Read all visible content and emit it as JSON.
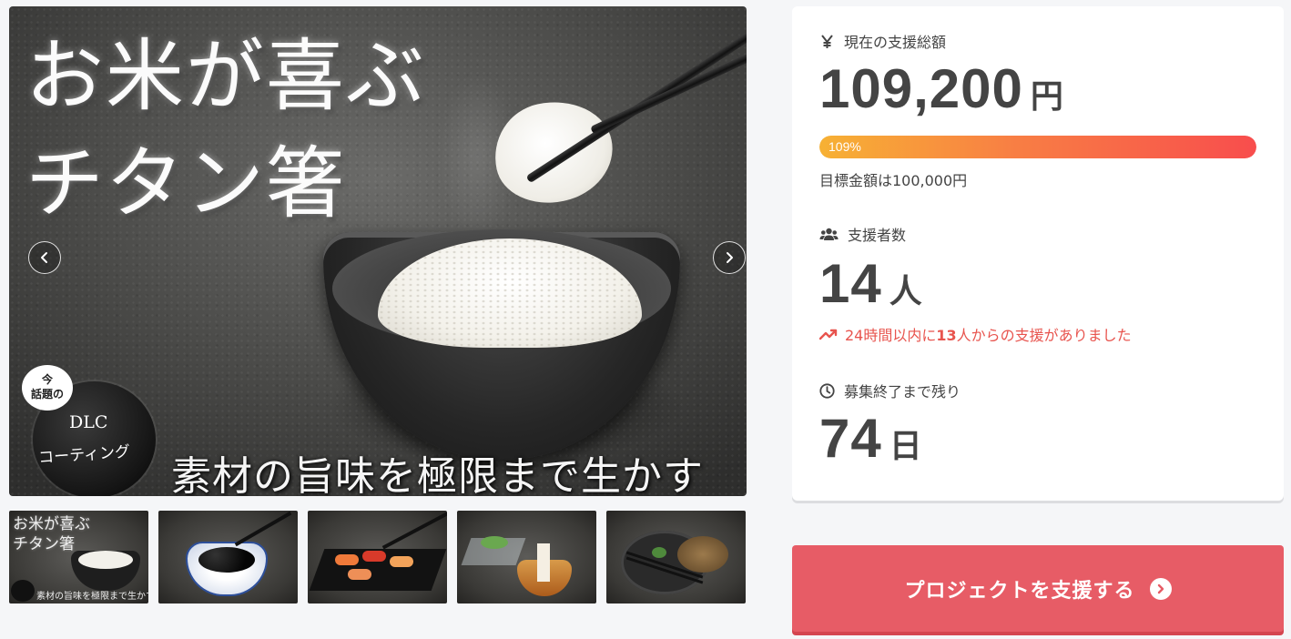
{
  "gallery": {
    "headline_line1": "お米が喜ぶ",
    "headline_line2": "チタン箸",
    "tagline": "素材の旨味を極限まで生かす",
    "badge": {
      "bubble_line1": "今",
      "bubble_line2": "話題の",
      "title": "DLC",
      "subtitle": "コーティング"
    },
    "prev_icon": "chevron-left-icon",
    "next_icon": "chevron-right-icon",
    "thumbnails": [
      {
        "label_line1": "お米が喜ぶ",
        "label_line2": "チタン箸",
        "bottom": "素材の旨味を極限まで生かす"
      },
      {
        "label_line1": "",
        "label_line2": "",
        "bottom": ""
      },
      {
        "label_line1": "",
        "label_line2": "",
        "bottom": ""
      },
      {
        "label_line1": "",
        "label_line2": "",
        "bottom": ""
      },
      {
        "label_line1": "",
        "label_line2": "",
        "bottom": ""
      }
    ]
  },
  "stats": {
    "funding_label": "現在の支援総額",
    "funding_icon": "yen-icon",
    "funding_amount": "109,200",
    "funding_unit": "円",
    "progress_percent": 109,
    "progress_label": "109%",
    "goal_text": "目標金額は100,000円",
    "backers_label": "支援者数",
    "backers_icon": "users-icon",
    "backers_count": "14",
    "backers_unit": "人",
    "trend_prefix": "24時間以内に",
    "trend_count": "13",
    "trend_suffix": "人からの支援がありました",
    "trend_icon": "trending-up-icon",
    "remaining_label": "募集終了まで残り",
    "remaining_icon": "clock-icon",
    "remaining_days": "74",
    "remaining_unit": "日"
  },
  "cta": {
    "label": "プロジェクトを支援する",
    "icon": "circle-arrow-right-icon"
  },
  "colors": {
    "accent": "#e75c66",
    "progress_start": "#f7b134",
    "progress_end": "#f84d4d",
    "trend": "#e8544e"
  }
}
